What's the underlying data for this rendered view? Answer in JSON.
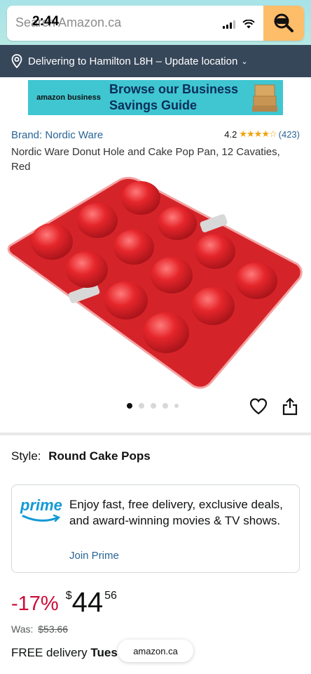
{
  "status_bar": {
    "time": "2:44"
  },
  "search": {
    "placeholder": "Search Amazon.ca"
  },
  "location": {
    "text": "Delivering to Hamilton L8H – Update location"
  },
  "banner": {
    "logo_text": "amazon business",
    "headline": "Browse our Business Savings Guide"
  },
  "product": {
    "brand": "Brand: Nordic Ware",
    "rating_value": "4.2",
    "stars": "★★★★☆",
    "rating_count": "(423)",
    "title": "Nordic Ware Donut Hole and Cake Pop Pan, 12 Cavaties, Red"
  },
  "carousel": {
    "image_count": 5,
    "active_index": 0
  },
  "style": {
    "label": "Style:",
    "value": "Round Cake Pops"
  },
  "prime": {
    "logo": "prime",
    "description": "Enjoy fast, free delivery, exclusive deals, and award-winning movies & TV shows.",
    "link": "Join Prime"
  },
  "price": {
    "discount": "-17%",
    "currency": "$",
    "whole": "44",
    "fraction": "56",
    "was_label": "Was:",
    "was_price": "$53.66"
  },
  "delivery": {
    "prefix": "FREE delivery",
    "day": "Tues"
  },
  "browser": {
    "url": "amazon.ca"
  },
  "colors": {
    "header_bg": "#a7e3e7",
    "location_bg": "#37475a",
    "search_button": "#febd69",
    "banner_bg": "#3fc6d1",
    "link": "#2a6496",
    "discount": "#cc0c39",
    "prime_blue": "#1399d4",
    "product_red": "#e0262b"
  }
}
